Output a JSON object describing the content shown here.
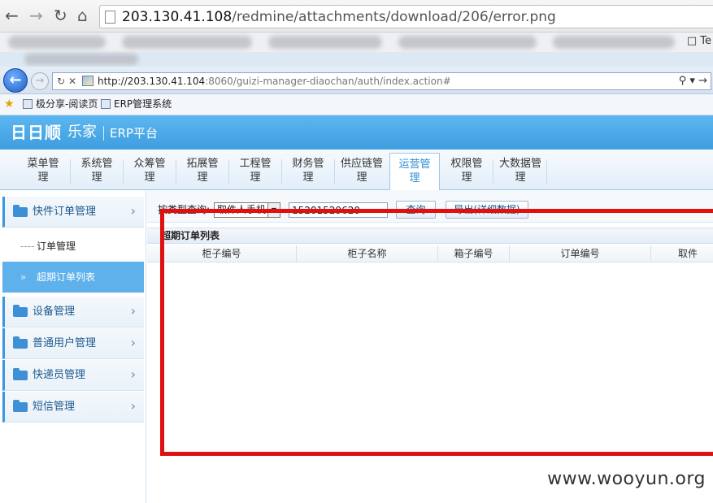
{
  "outer_browser": {
    "back_icon": "arrow-left-icon",
    "forward_icon": "arrow-right-icon",
    "reload_icon": "reload-icon",
    "home_icon": "home-icon",
    "url_host": "203.130.41.108",
    "url_path": "/redmine/attachments/download/206/error.png",
    "bookmark_tail": "Te"
  },
  "ie_browser": {
    "url_host": "http://203.130.41.104",
    "url_path": ":8060/guizi-manager-diaochan/auth/index.action#",
    "favorites": [
      "极分享-阅读页",
      "ERP管理系统"
    ]
  },
  "app": {
    "logo": "日日顺",
    "logo_sub": "乐家",
    "platform": "ERP平台",
    "nav": [
      {
        "label": "菜单管理",
        "active": false
      },
      {
        "label": "系统管理",
        "active": false
      },
      {
        "label": "众筹管理",
        "active": false
      },
      {
        "label": "拓展管理",
        "active": false
      },
      {
        "label": "工程管理",
        "active": false
      },
      {
        "label": "财务管理",
        "active": false
      },
      {
        "label": "供应链管理",
        "active": false
      },
      {
        "label": "运营管理",
        "active": true
      },
      {
        "label": "权限管理",
        "active": false
      },
      {
        "label": "大数据管理",
        "active": false
      }
    ]
  },
  "sidebar": {
    "groups": [
      {
        "label": "快件订单管理"
      },
      {
        "label": "设备管理"
      },
      {
        "label": "普通用户管理"
      },
      {
        "label": "快递员管理"
      },
      {
        "label": "短信管理"
      }
    ],
    "subs": [
      {
        "label": "订单管理",
        "active": false
      },
      {
        "label": "超期订单列表",
        "active": true
      }
    ]
  },
  "search": {
    "label": "按类型查询:",
    "select_value": "取件人手机",
    "input_value": "15201529620",
    "query_button": "查询",
    "export_button": "导出(详细数据)"
  },
  "panel": {
    "title": "超期订单列表",
    "columns": [
      "柜子编号",
      "柜子名称",
      "箱子编号",
      "订单编号",
      "取件"
    ]
  },
  "watermark": "www.wooyun.org",
  "colors": {
    "accent": "#3f9ee0",
    "highlight_frame": "#e01010"
  }
}
